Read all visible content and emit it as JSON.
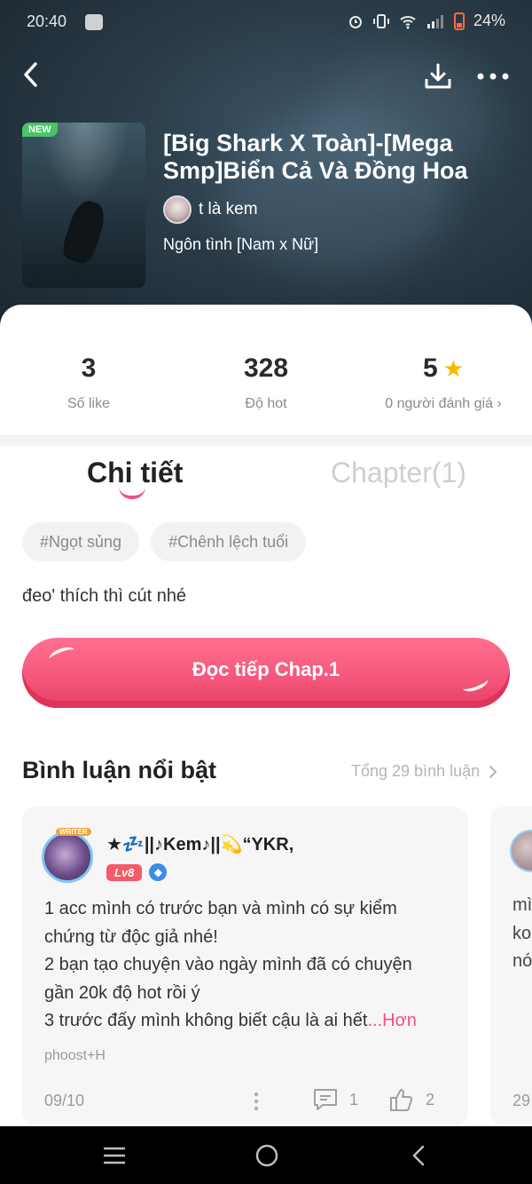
{
  "status_bar": {
    "time": "20:40",
    "battery": "24%"
  },
  "story": {
    "badge": "NEW",
    "title": "[Big Shark X Toàn]-[Mega Smp]Biển Cả Và Đồng Hoa",
    "author": "t là kem",
    "genre": "Ngôn tình [Nam x Nữ]"
  },
  "stats": {
    "likes_value": "3",
    "likes_label": "Số like",
    "hot_value": "328",
    "hot_label": "Độ hot",
    "rating_value": "5",
    "rating_label": "0 người đánh giá"
  },
  "tabs": {
    "detail": "Chi tiết",
    "chapter": "Chapter(1)",
    "active": "detail"
  },
  "tags": [
    "#Ngọt sủng",
    "#Chênh lệch tuổi"
  ],
  "description": "đeo' thích thì cút nhé",
  "read_button": "Đọc tiếp Chap.1",
  "comments": {
    "section_title": "Bình luận nổi bật",
    "total": "Tổng 29 bình luận",
    "items": [
      {
        "avatar_badge": "WRITER",
        "username": "★💤||♪Kem♪||💫“YKR,",
        "level": "Lv8",
        "body_lines": [
          "1 acc mình có trước bạn và mình có sự kiểm",
          "chứng từ độc giả nhé!",
          "2 bạn tạo chuyện vào ngày mình đã có chuyện",
          "gần 20k độ hot rồi ý",
          "3 trước đấy mình không biết cậu là ai hết"
        ],
        "more": "...Hơn",
        "signature": "phoost+H",
        "date": "09/10",
        "reply_count": "1",
        "like_count": "2"
      },
      {
        "body_lines": [
          "mì",
          "ko",
          "nó"
        ],
        "date": "29"
      }
    ]
  },
  "colors": {
    "accent": "#f0507f",
    "button": "#f5567b",
    "star": "#f5b800",
    "new_badge": "#4cc36b"
  }
}
